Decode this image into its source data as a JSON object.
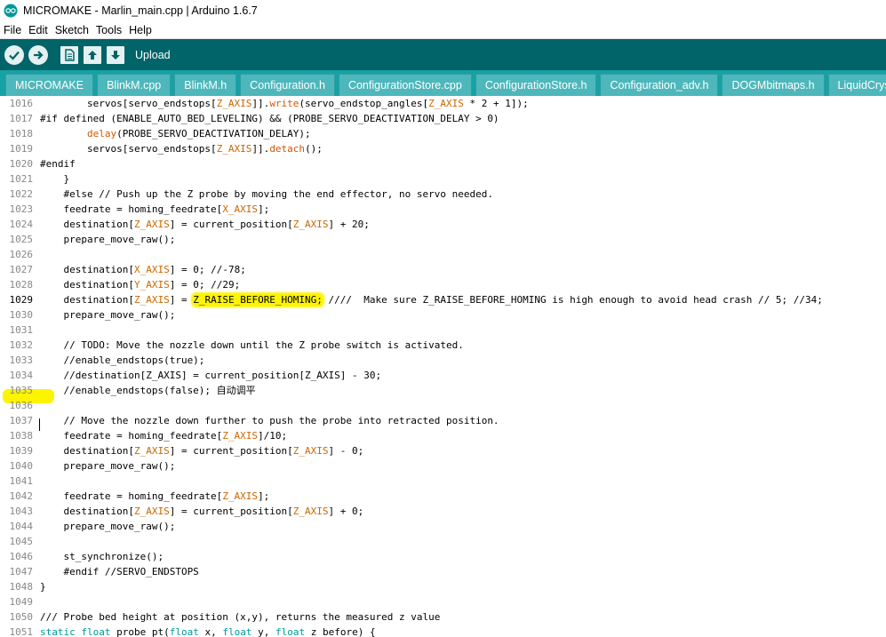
{
  "window": {
    "title": "MICROMAKE - Marlin_main.cpp | Arduino 1.6.7"
  },
  "menu": [
    "File",
    "Edit",
    "Sketch",
    "Tools",
    "Help"
  ],
  "toolbar": {
    "upload_label": "Upload"
  },
  "tabs": [
    "MICROMAKE",
    "BlinkM.cpp",
    "BlinkM.h",
    "Configuration.h",
    "ConfigurationStore.cpp",
    "ConfigurationStore.h",
    "Configuration_adv.h",
    "DOGMbitmaps.h",
    "LiquidCrystalR"
  ],
  "colors": {
    "toolbar_bg": "#006468",
    "tabbar_bg": "#17a1a5",
    "tab_bg": "#4db7bb",
    "highlight": "#fcf400"
  },
  "code": {
    "current_line": "1029",
    "lines": [
      {
        "n": "1016",
        "t": "        servos[servo_endstops[Z_AXIS]].write(servo_endstop_angles[Z_AXIS * 2 + 1]);"
      },
      {
        "n": "1017",
        "t": "#if defined (ENABLE_AUTO_BED_LEVELING) && (PROBE_SERVO_DEACTIVATION_DELAY > 0)"
      },
      {
        "n": "1018",
        "t": "        delay(PROBE_SERVO_DEACTIVATION_DELAY);"
      },
      {
        "n": "1019",
        "t": "        servos[servo_endstops[Z_AXIS]].detach();"
      },
      {
        "n": "1020",
        "t": "#endif"
      },
      {
        "n": "1021",
        "t": "    }"
      },
      {
        "n": "1022",
        "t": "    #else // Push up the Z probe by moving the end effector, no servo needed."
      },
      {
        "n": "1023",
        "t": "    feedrate = homing_feedrate[X_AXIS];"
      },
      {
        "n": "1024",
        "t": "    destination[Z_AXIS] = current_position[Z_AXIS] + 20;"
      },
      {
        "n": "1025",
        "t": "    prepare_move_raw();"
      },
      {
        "n": "1026",
        "t": ""
      },
      {
        "n": "1027",
        "t": "    destination[X_AXIS] = 0; //-78;"
      },
      {
        "n": "1028",
        "t": "    destination[Y_AXIS] = 0; //29;"
      },
      {
        "n": "1029",
        "t": "    destination[Z_AXIS] = Z_RAISE_BEFORE_HOMING; ////  Make sure Z_RAISE_BEFORE_HOMING is high enough to avoid head crash // 5; //34;"
      },
      {
        "n": "1030",
        "t": "    prepare_move_raw();"
      },
      {
        "n": "1031",
        "t": ""
      },
      {
        "n": "1032",
        "t": "    // TODO: Move the nozzle down until the Z probe switch is activated."
      },
      {
        "n": "1033",
        "t": "    //enable_endstops(true);"
      },
      {
        "n": "1034",
        "t": "    //destination[Z_AXIS] = current_position[Z_AXIS] - 30;"
      },
      {
        "n": "1035",
        "t": "    //enable_endstops(false); 自动调平"
      },
      {
        "n": "1036",
        "t": ""
      },
      {
        "n": "1037",
        "t": "    // Move the nozzle down further to push the probe into retracted position."
      },
      {
        "n": "1038",
        "t": "    feedrate = homing_feedrate[Z_AXIS]/10;"
      },
      {
        "n": "1039",
        "t": "    destination[Z_AXIS] = current_position[Z_AXIS] - 0;"
      },
      {
        "n": "1040",
        "t": "    prepare_move_raw();"
      },
      {
        "n": "1041",
        "t": ""
      },
      {
        "n": "1042",
        "t": "    feedrate = homing_feedrate[Z_AXIS];"
      },
      {
        "n": "1043",
        "t": "    destination[Z_AXIS] = current_position[Z_AXIS] + 0;"
      },
      {
        "n": "1044",
        "t": "    prepare_move_raw();"
      },
      {
        "n": "1045",
        "t": ""
      },
      {
        "n": "1046",
        "t": "    st_synchronize();"
      },
      {
        "n": "1047",
        "t": "    #endif //SERVO_ENDSTOPS"
      },
      {
        "n": "1048",
        "t": "}"
      },
      {
        "n": "1049",
        "t": ""
      },
      {
        "n": "1050",
        "t": "/// Probe bed height at position (x,y), returns the measured z value"
      },
      {
        "n": "1051",
        "t": "static float probe_pt(float x, float y, float z_before) {"
      }
    ]
  }
}
